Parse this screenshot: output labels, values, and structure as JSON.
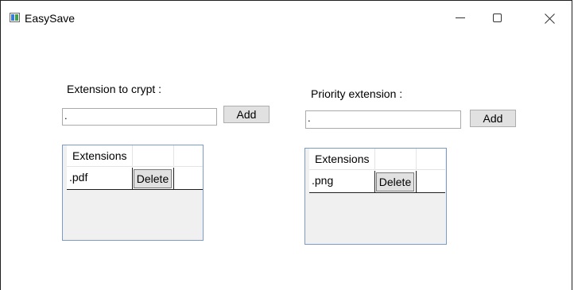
{
  "window": {
    "title": "EasySave",
    "controls": {
      "minimize": "minimize-icon",
      "maximize": "maximize-icon",
      "close": "close-icon"
    }
  },
  "crypt": {
    "label": "Extension to crypt :",
    "input_value": ".",
    "add_label": "Add",
    "grid": {
      "column_header": "Extensions",
      "rows": [
        {
          "extension": ".pdf",
          "action": "Delete"
        }
      ]
    }
  },
  "priority": {
    "label": "Priority extension :",
    "input_value": ".",
    "add_label": "Add",
    "grid": {
      "column_header": "Extensions",
      "rows": [
        {
          "extension": ".png",
          "action": "Delete"
        }
      ]
    }
  }
}
